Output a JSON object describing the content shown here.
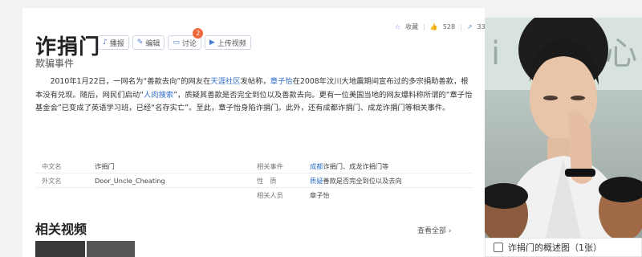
{
  "entry": {
    "title": "诈捐门",
    "subtitle": "欺骗事件"
  },
  "actions": [
    {
      "icon": "microphone-icon",
      "label": "播报"
    },
    {
      "icon": "edit-icon",
      "label": "编辑"
    },
    {
      "icon": "comment-icon",
      "label": "讨论",
      "badge": "2"
    },
    {
      "icon": "video-icon",
      "label": "上传视频"
    }
  ],
  "stats": {
    "favorite_label": "收藏",
    "likes": "528",
    "shares": "33"
  },
  "summary": {
    "p1": "2010年1月22日，一网名为“善款去向”的网友在",
    "link1": "天涯社区",
    "p2": "发帖称，",
    "link2": "章子怡",
    "p3": "在2008年汶川大地震期间宣布过的多宗捐助善款，根本没有兑现。随后，网民们启动“",
    "link3": "人肉搜索",
    "p4": "”，质疑其善款是否完全到位以及善款去向。更有一位美国当地的网友爆料称所谓的“章子怡基金会”已变成了英语学习班，已经“名存实亡”。至此，章子怡身陷诈捐门。此外，还有成都诈捐门、成龙诈捐门等相关事件。"
  },
  "infobox": {
    "rows": [
      {
        "k1": "中文名",
        "v1": "诈捐门",
        "k2": "相关事件",
        "v2_link": "成都",
        "v2": "诈捐门、成龙诈捐门等"
      },
      {
        "k1": "外文名",
        "v1": "Door_Uncle_Cheating",
        "k2": "性　质",
        "v2_link": "质疑",
        "v2": "善款是否完全到位以及去向"
      },
      {
        "k1": "",
        "v1": "",
        "k2": "相关人员",
        "v2_link": "",
        "v2": "章子怡"
      }
    ]
  },
  "related_videos": {
    "title": "相关视频",
    "more_label": "查看全部"
  },
  "photo": {
    "caption": "诈捐门的概述图（1张）"
  },
  "colors": {
    "link": "#2f6fc9",
    "badge": "#f0673a"
  }
}
